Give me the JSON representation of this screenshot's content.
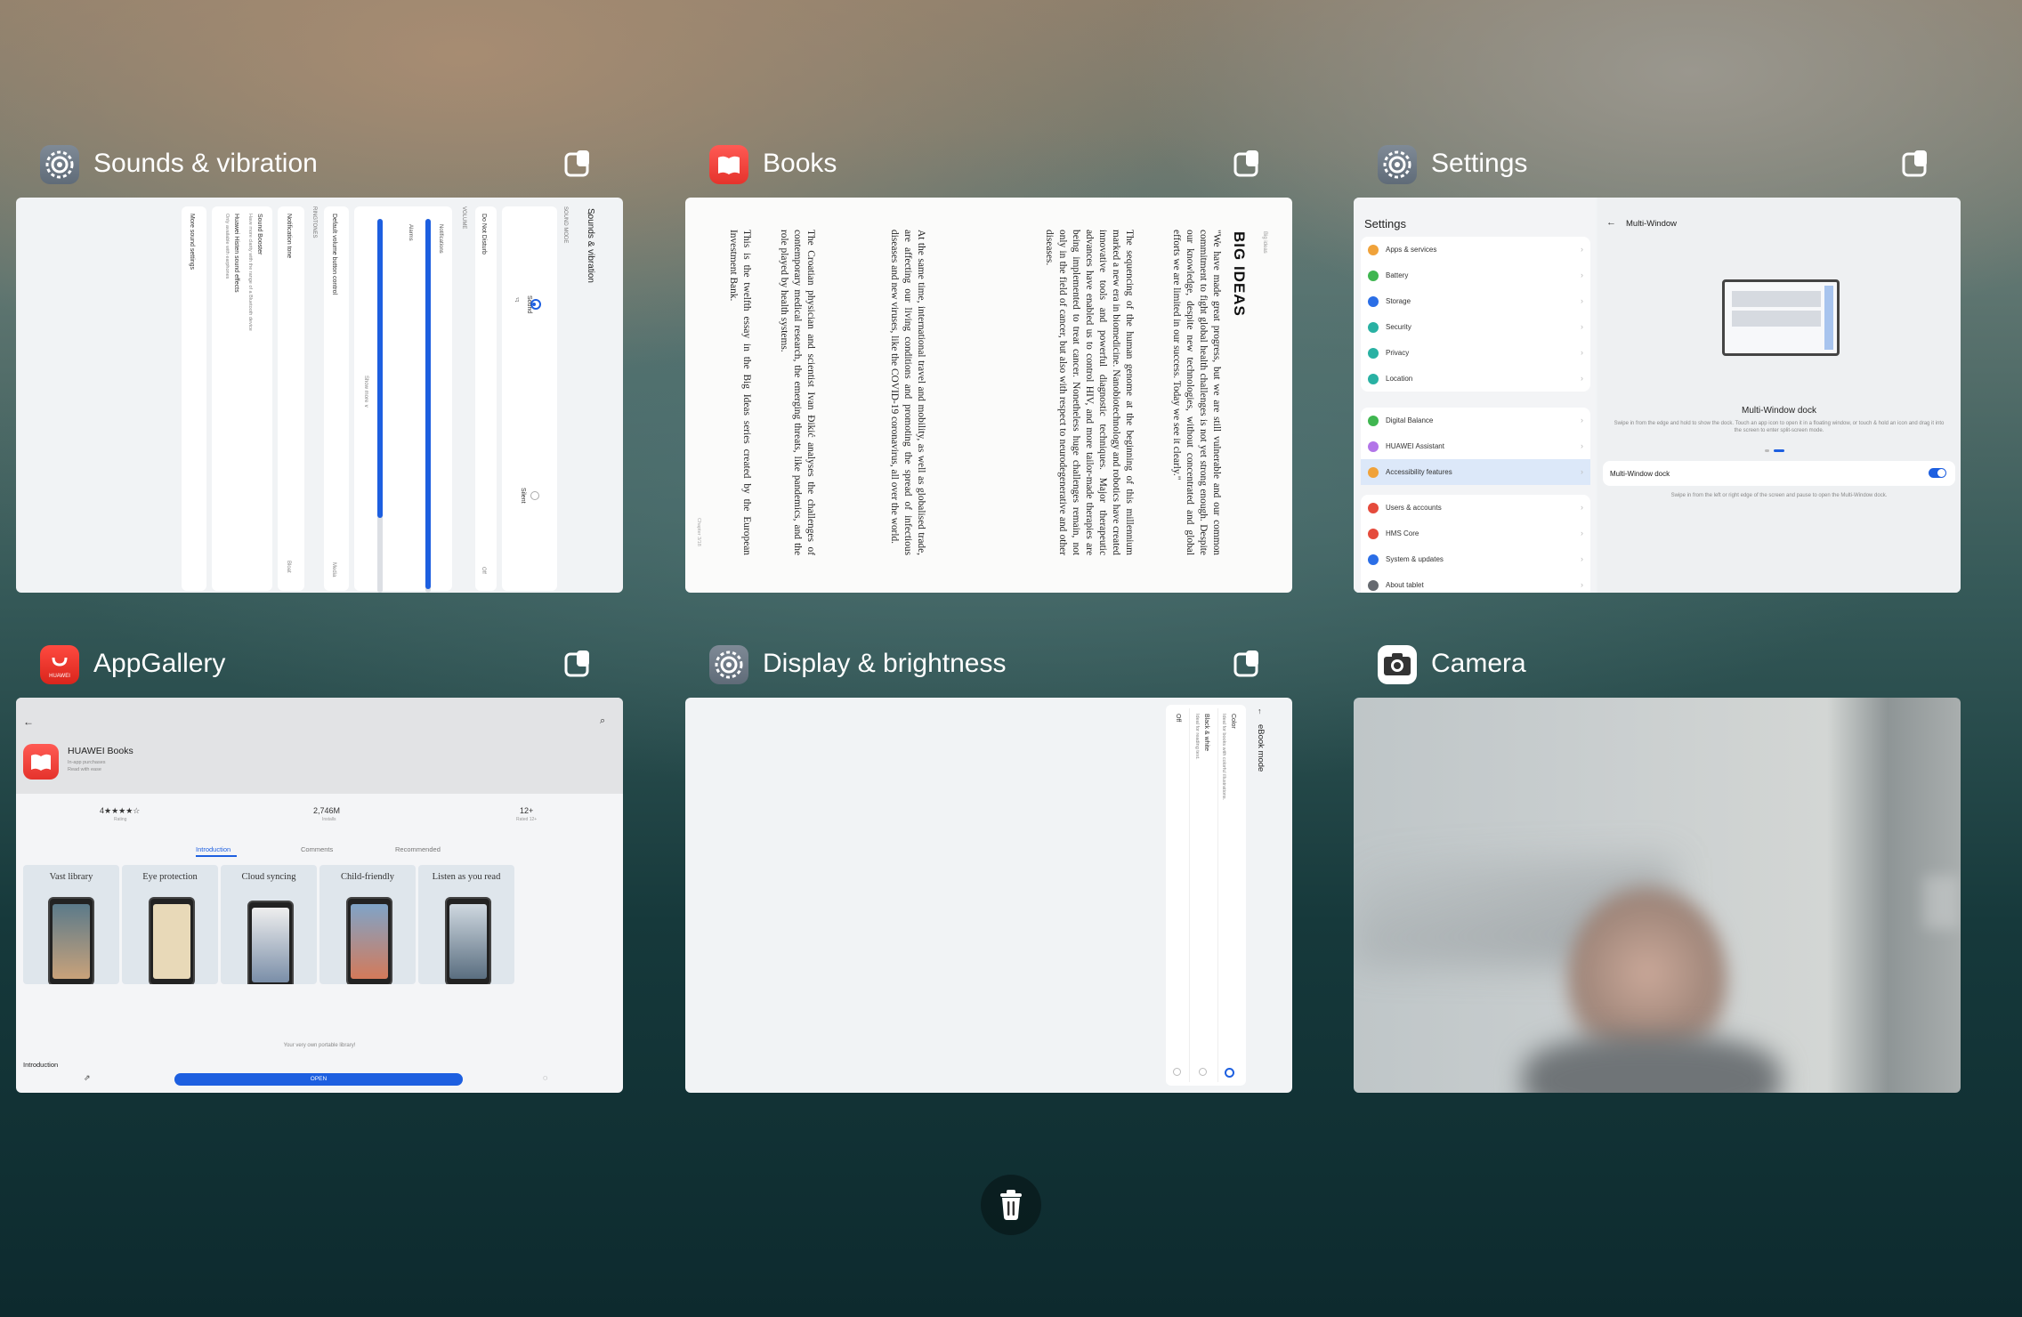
{
  "cards": [
    {
      "app_name": "Sounds & vibration",
      "icon": "settings-gear-icon",
      "thumb": {
        "header": "Sounds & vibration",
        "sound_mode": "SOUND MODE",
        "mode_sound": "Sound",
        "mode_silent": "Silent",
        "dnd": "Do Not Disturb",
        "dnd_value": "Off",
        "volume": "VOLUME",
        "notifications": "Notifications",
        "alarms": "Alarms",
        "show_more": "Show more ∨",
        "default_volume_control": "Default volume button control",
        "default_volume_value": "Media",
        "ringtones": "RINGTONES",
        "notification_tone": "Notification tone",
        "notification_tone_value": "Bloat",
        "sound_booster": "Sound Booster",
        "sound_booster_desc": "Have more clarity with the range of a Bluetooth device",
        "huawei_histen": "Huawei Histen sound effects",
        "huawei_histen_desc": "Only available with earphones",
        "more_sound_settings": "More sound settings"
      }
    },
    {
      "app_name": "Books",
      "icon": "books-icon",
      "thumb": {
        "running_head": "Big ideas",
        "heading": "BIG IDEAS",
        "paragraphs": [
          "\"We have made great progress, but we are still vulnerable and our common commitment to fight global health challenges is not yet strong enough. Despite our knowledge, despite new technologies, without concentrated and global efforts we are limited in our success. Today we see it clearly.\"",
          "The sequencing of the human genome at the beginning of this millennium marked a new era in biomedicine. Nanobiotechnology and robotics have created innovative tools and powerful diagnostic techniques. Major therapeutic advances have enabled us to control HIV, and more tailor-made therapies are being implemented to treat cancer. Nonetheless huge challenges remain, not only in the field of cancer, but also with respect to neurodegenerative and other diseases.",
          "At the same time, international travel and mobility, as well as globalised trade, are affecting our living conditions and promoting the spread of infectious diseases and new viruses, like the COVID-19 coronavirus, all over the world.",
          "The Croatian physician and scientist Ivan Đikić analyses the challenges of contemporary medical research, the emerging threats, like pandemics, and the role played by health systems.",
          "This is the twelfth essay in the Big Ideas series created by the European Investment Bank."
        ],
        "page_footer": "Chapter 3/18"
      }
    },
    {
      "app_name": "Settings",
      "icon": "settings-gear-icon",
      "thumb": {
        "title": "Settings",
        "groups": [
          [
            {
              "label": "Apps & services",
              "color": "#f0a23a"
            },
            {
              "label": "Battery",
              "color": "#3fb650"
            },
            {
              "label": "Storage",
              "color": "#2b6ee6"
            },
            {
              "label": "Security",
              "color": "#29b1a3"
            },
            {
              "label": "Privacy",
              "color": "#29b1a3"
            },
            {
              "label": "Location",
              "color": "#29b1a3"
            }
          ],
          [
            {
              "label": "Digital Balance",
              "color": "#3fb650"
            },
            {
              "label": "HUAWEI Assistant",
              "color": "#b275e8"
            },
            {
              "label": "Accessibility features",
              "color": "#f0a23a",
              "active": true
            }
          ],
          [
            {
              "label": "Users & accounts",
              "color": "#e54b3c"
            },
            {
              "label": "HMS Core",
              "color": "#e54b3c"
            },
            {
              "label": "System & updates",
              "color": "#2b6ee6"
            },
            {
              "label": "About tablet",
              "color": "#666a70"
            }
          ]
        ],
        "detail_title": "Multi-Window",
        "dock_title": "Multi-Window dock",
        "dock_desc": "Swipe in from the edge and hold to show the dock. Touch an app icon to open it in a floating window, or touch & hold an icon and drag it into the screen to enter split-screen mode.",
        "toggle_label": "Multi-Window dock",
        "toggle_desc": "Swipe in from the left or right edge of the screen and pause to open the Multi-Window dock."
      }
    },
    {
      "app_name": "AppGallery",
      "icon": "appgallery-icon",
      "icon_text": "HUAWEI",
      "thumb": {
        "app_title": "HUAWEI Books",
        "app_sub1": "In-app purchases",
        "app_sub2": "Read with ease",
        "stat_rating": "4★★★★☆",
        "stat_rating_label": "Rating",
        "stat_installs": "2,746M",
        "stat_installs_label": "Installs",
        "stat_age": "12+",
        "stat_age_label": "Rated 12+",
        "tabs": [
          "Introduction",
          "Comments",
          "Recommended"
        ],
        "shots": [
          "Vast library",
          "Eye protection",
          "Cloud syncing",
          "Child-friendly",
          "Listen as you read"
        ],
        "tagline": "Your very own portable library!",
        "section": "Introduction",
        "open_button": "OPEN"
      }
    },
    {
      "app_name": "Display & brightness",
      "icon": "settings-gear-icon",
      "thumb": {
        "header": "eBook mode",
        "color": "Color",
        "color_desc": "Ideal for books with colorful illustrations.",
        "bw": "Black & white",
        "bw_desc": "Ideal for reading text.",
        "off": "Off"
      }
    },
    {
      "app_name": "Camera",
      "icon": "camera-icon"
    }
  ],
  "clear_all": "trash-icon"
}
